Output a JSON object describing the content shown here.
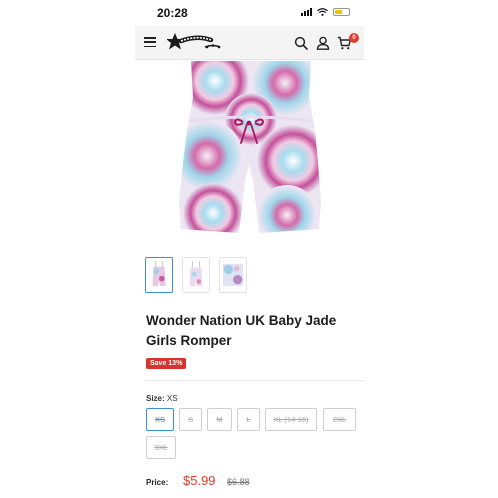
{
  "status_bar": {
    "time": "20:28"
  },
  "header": {
    "menu_icon": "hamburger-menu-icon",
    "logo_alt": "store logo",
    "search_icon": "search-icon",
    "account_icon": "user-icon",
    "cart_icon": "cart-icon",
    "cart_count": "0",
    "colors": {
      "bar_bg": "#f4f4f4",
      "badge": "#e53a2e"
    }
  },
  "product": {
    "title": "Wonder Nation UK Baby Jade Girls Romper",
    "save_badge": "Save 13%",
    "size_label": "Size:",
    "size_value": "XS",
    "sizes": [
      "XS",
      "S",
      "M",
      "L",
      "XL (14-16)",
      "2XL",
      "3XL"
    ],
    "selected_size": "XS",
    "price_label": "Price:",
    "price_current": "$5.99",
    "price_original": "$6.88",
    "thumbnails": 3,
    "colors": {
      "accent": "#3a8fd3",
      "sale": "#d8342c",
      "price": "#e53a2e"
    }
  }
}
